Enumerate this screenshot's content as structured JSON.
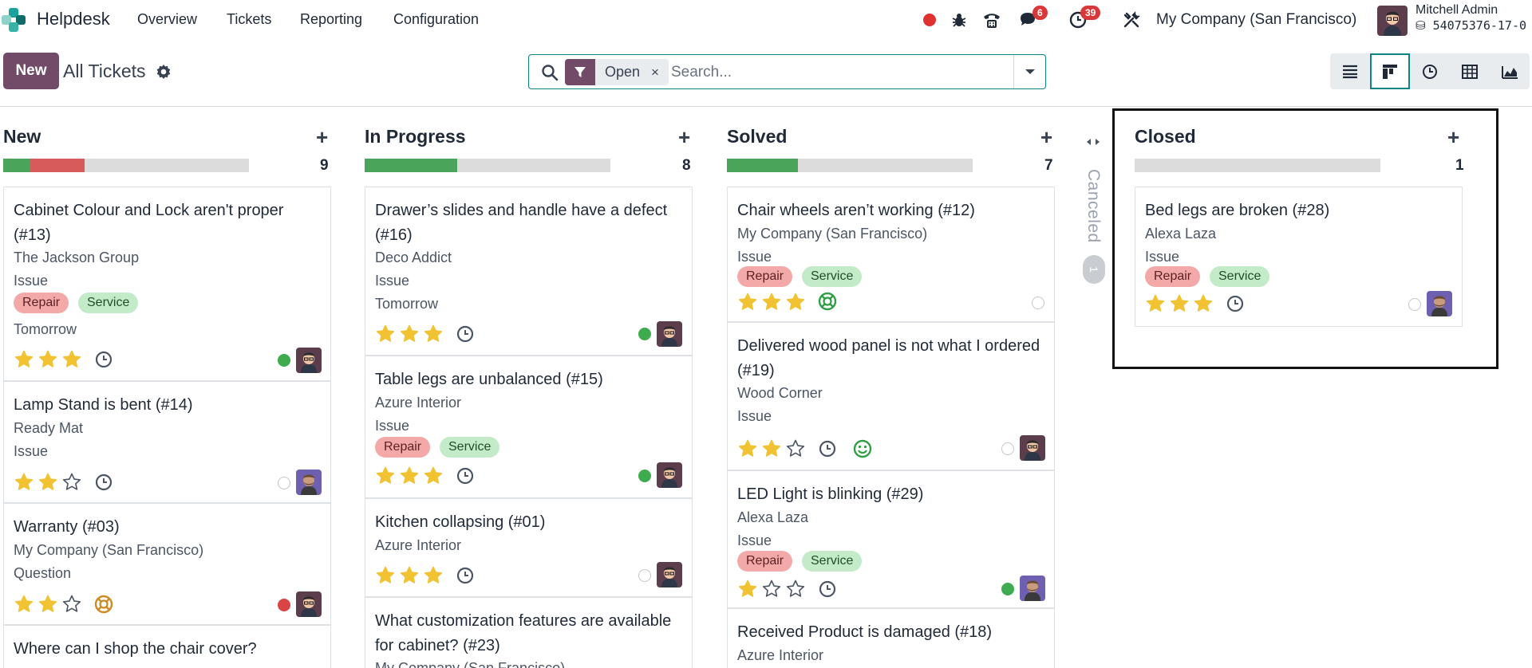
{
  "app": {
    "name": "Helpdesk"
  },
  "nav": {
    "menus": [
      "Overview",
      "Tickets",
      "Reporting",
      "Configuration"
    ],
    "chat_badge": "6",
    "activity_badge": "39",
    "company": "My Company (San Francisco)",
    "user_name": "Mitchell Admin",
    "db_name": "54075376-17-0"
  },
  "control": {
    "new_label": "New",
    "title": "All Tickets",
    "facet_label": "Open",
    "facet_close": "×",
    "search_placeholder": "Search..."
  },
  "colors": {
    "brand": "#714b67",
    "accent": "#0c8585",
    "progress_green": "#4aa55a",
    "progress_red": "#d75b5b",
    "star": "#f1c232"
  },
  "columns": [
    {
      "title": "New",
      "count": "9",
      "progress": {
        "green": 0.11,
        "red": 0.22
      }
    },
    {
      "title": "In Progress",
      "count": "8",
      "progress": {
        "green": 0.375,
        "red": 0
      }
    },
    {
      "title": "Solved",
      "count": "7",
      "progress": {
        "green": 0.29,
        "red": 0
      }
    },
    {
      "title": "Closed",
      "count": "1",
      "progress": {
        "green": 0,
        "red": 0
      }
    }
  ],
  "folded_column": {
    "title": "Canceled",
    "count": "1"
  },
  "add_label": "+",
  "tags": {
    "repair": "Repair",
    "service": "Service"
  },
  "cards": {
    "c13": {
      "title": "Cabinet Colour and Lock aren't proper (#13)",
      "customer": "The Jackson Group",
      "type": "Issue",
      "deadline": "Tomorrow",
      "rating": 3,
      "status": "green"
    },
    "c14": {
      "title": "Lamp Stand is bent (#14)",
      "customer": "Ready Mat",
      "type": "Issue",
      "rating": 2,
      "status": "grey"
    },
    "c03": {
      "title": "Warranty (#03)",
      "customer": "My Company (San Francisco)",
      "type": "Question",
      "rating": 2,
      "status": "red"
    },
    "c_shop": {
      "title": "Where can I shop the chair cover?"
    },
    "c16": {
      "title": "Drawer’s slides and handle have a defect (#16)",
      "customer": "Deco Addict",
      "type": "Issue",
      "deadline": "Tomorrow",
      "rating": 3,
      "status": "green"
    },
    "c15": {
      "title": "Table legs are unbalanced (#15)",
      "customer": "Azure Interior",
      "type": "Issue",
      "rating": 3,
      "status": "green"
    },
    "c01": {
      "title": "Kitchen collapsing (#01)",
      "customer": "Azure Interior",
      "rating": 3,
      "status": "grey"
    },
    "c23": {
      "title": "What customization features are available for cabinet? (#23)",
      "customer": "My Company (San Francisco)"
    },
    "c12": {
      "title": "Chair wheels aren’t working (#12)",
      "customer": "My Company (San Francisco)",
      "type": "Issue",
      "rating": 3,
      "status": "grey"
    },
    "c19": {
      "title": "Delivered wood panel is not what I ordered (#19)",
      "customer": "Wood Corner",
      "type": "Issue",
      "rating": 2,
      "status": "grey"
    },
    "c29": {
      "title": "LED Light is blinking (#29)",
      "customer": "Alexa Laza",
      "type": "Issue",
      "rating": 1,
      "status": "green"
    },
    "c18": {
      "title": "Received Product is damaged (#18)",
      "customer": "Azure Interior"
    },
    "c28": {
      "title": "Bed legs are broken (#28)",
      "customer": "Alexa Laza",
      "type": "Issue",
      "rating": 3,
      "status": "grey"
    }
  }
}
